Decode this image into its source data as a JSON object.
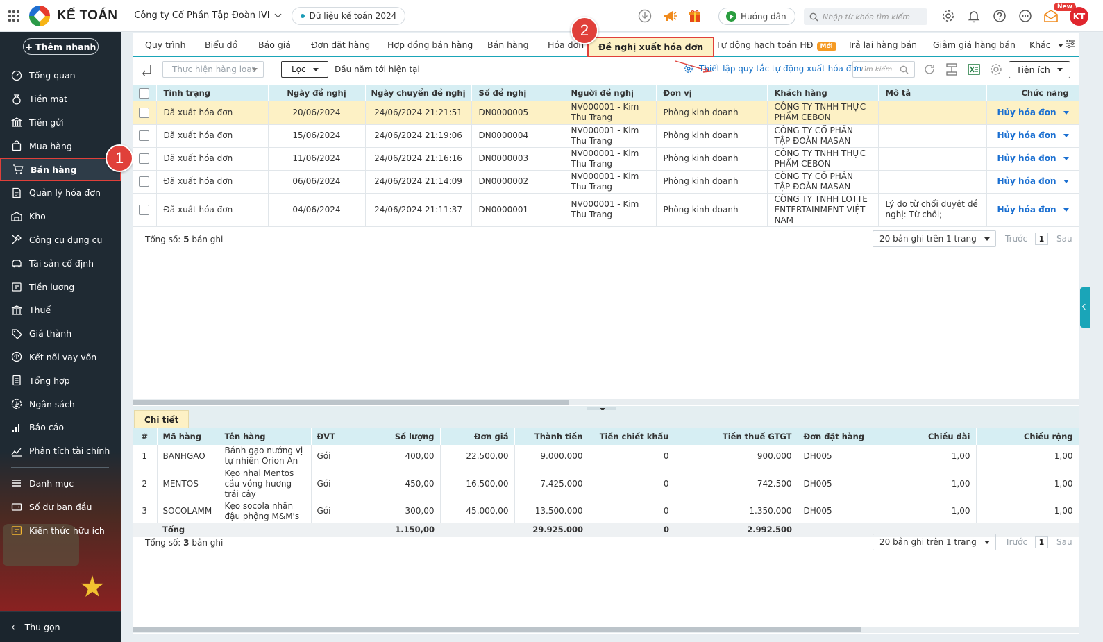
{
  "app": {
    "logo_text": "KẾ TOÁN",
    "company": "Công ty Cổ Phần Tập Đoàn IVI",
    "data_year": "Dữ liệu kế toán 2024",
    "guide_label": "Hướng dẫn",
    "search_placeholder": "Nhập từ khóa tìm kiếm",
    "new_badge": "New",
    "avatar_initials": "KT"
  },
  "sidebar": {
    "quick_add": "Thêm nhanh",
    "items": [
      {
        "label": "Tổng quan",
        "icon": "dashboard-icon"
      },
      {
        "label": "Tiền mặt",
        "icon": "cash-icon"
      },
      {
        "label": "Tiền gửi",
        "icon": "bank-icon"
      },
      {
        "label": "Mua hàng",
        "icon": "purchase-bag-icon"
      },
      {
        "label": "Bán hàng",
        "icon": "cart-icon"
      },
      {
        "label": "Quản lý hóa đơn",
        "icon": "invoice-icon"
      },
      {
        "label": "Kho",
        "icon": "warehouse-icon"
      },
      {
        "label": "Công cụ dụng cụ",
        "icon": "tools-icon"
      },
      {
        "label": "Tài sản cố định",
        "icon": "asset-icon"
      },
      {
        "label": "Tiền lương",
        "icon": "salary-icon"
      },
      {
        "label": "Thuế",
        "icon": "tax-icon"
      },
      {
        "label": "Giá thành",
        "icon": "price-tag-icon"
      },
      {
        "label": "Kết nối vay vốn",
        "icon": "loan-icon"
      },
      {
        "label": "Tổng hợp",
        "icon": "summary-icon"
      },
      {
        "label": "Ngân sách",
        "icon": "budget-icon"
      },
      {
        "label": "Báo cáo",
        "icon": "report-icon"
      },
      {
        "label": "Phân tích tài chính",
        "icon": "analysis-icon"
      },
      {
        "label": "Danh mục",
        "icon": "list-icon"
      },
      {
        "label": "Số dư ban đầu",
        "icon": "balance-icon"
      },
      {
        "label": "Kiến thức hữu ích",
        "icon": "knowledge-icon"
      }
    ],
    "collapse_label": "Thu gọn"
  },
  "callouts": {
    "one": "1",
    "two": "2"
  },
  "tabs": [
    {
      "label": "Quy trình"
    },
    {
      "label": "Biểu đồ"
    },
    {
      "label": "Báo giá"
    },
    {
      "label": "Đơn đặt hàng"
    },
    {
      "label": "Hợp đồng bán hàng"
    },
    {
      "label": "Bán hàng"
    },
    {
      "label": "Hóa đơn"
    },
    {
      "label": "Đề nghị xuất hóa đơn"
    },
    {
      "label": "Tự động hạch toán HĐ",
      "badge": "Mới"
    },
    {
      "label": "Trả lại hàng bán"
    },
    {
      "label": "Giảm giá hàng bán"
    },
    {
      "label": "Khác"
    }
  ],
  "toolbar": {
    "bulk_placeholder": "Thực hiện hàng loạt",
    "filter_label": "Lọc",
    "period": "Đầu năm tới hiện tại",
    "setup_link": "Thiết lập quy tắc tự động xuất hóa đơn",
    "search_placeholder": "Tìm kiếm",
    "utilities_label": "Tiện ích"
  },
  "proposals": {
    "columns": [
      "Tình trạng",
      "Ngày đề nghị",
      "Ngày chuyển đề nghị",
      "Số đề nghị",
      "Người đề nghị",
      "Đơn vị",
      "Khách hàng",
      "Mô tả",
      "Chức năng"
    ],
    "rows": [
      {
        "status": "Đã xuất hóa đơn",
        "date": "20/06/2024",
        "sent": "24/06/2024 21:21:51",
        "number": "DN0000005",
        "requester": "NV000001 - Kim Thu Trang",
        "unit": "Phòng kinh doanh",
        "customer": "CÔNG TY TNHH THỰC PHẨM CEBON",
        "note": "",
        "action": "Hủy hóa đơn"
      },
      {
        "status": "Đã xuất hóa đơn",
        "date": "15/06/2024",
        "sent": "24/06/2024 21:19:06",
        "number": "DN0000004",
        "requester": "NV000001 - Kim Thu Trang",
        "unit": "Phòng kinh doanh",
        "customer": "CÔNG TY CỔ PHẦN TẬP ĐOÀN MASAN",
        "note": "",
        "action": "Hủy hóa đơn"
      },
      {
        "status": "Đã xuất hóa đơn",
        "date": "11/06/2024",
        "sent": "24/06/2024 21:16:16",
        "number": "DN0000003",
        "requester": "NV000001 - Kim Thu Trang",
        "unit": "Phòng kinh doanh",
        "customer": "CÔNG TY TNHH THỰC PHẨM CEBON",
        "note": "",
        "action": "Hủy hóa đơn"
      },
      {
        "status": "Đã xuất hóa đơn",
        "date": "06/06/2024",
        "sent": "24/06/2024 21:14:09",
        "number": "DN0000002",
        "requester": "NV000001 - Kim Thu Trang",
        "unit": "Phòng kinh doanh",
        "customer": "CÔNG TY CỔ PHẦN TẬP ĐOÀN MASAN",
        "note": "",
        "action": "Hủy hóa đơn"
      },
      {
        "status": "Đã xuất hóa đơn",
        "date": "04/06/2024",
        "sent": "24/06/2024 21:11:37",
        "number": "DN0000001",
        "requester": "NV000001 - Kim Thu Trang",
        "unit": "Phòng kinh doanh",
        "customer": "CÔNG TY TNHH LOTTE ENTERTAINMENT VIỆT NAM",
        "note": "Lý do từ chối duyệt đề nghị: Từ chối;",
        "action": "Hủy hóa đơn"
      }
    ],
    "total_prefix": "Tổng số: ",
    "total_count": "5",
    "total_suffix": " bản ghi",
    "page_size": "20 bản ghi trên 1 trang",
    "prev": "Trước",
    "page": "1",
    "next": "Sau"
  },
  "detail": {
    "tab_label": "Chi tiết",
    "columns": [
      "#",
      "Mã hàng",
      "Tên hàng",
      "ĐVT",
      "Số lượng",
      "Đơn giá",
      "Thành tiền",
      "Tiền chiết khấu",
      "Tiền thuế GTGT",
      "Đơn đặt hàng",
      "Chiều dài",
      "Chiều rộng"
    ],
    "rows": [
      {
        "no": "1",
        "code": "BANHGAO",
        "name": "Bánh gạo nướng vị tự nhiên Orion An",
        "unit": "Gói",
        "qty": "400,00",
        "price": "22.500,00",
        "amount": "9.000.000",
        "discount": "0",
        "vat": "900.000",
        "order": "DH005",
        "length": "1,00",
        "width": "1,00"
      },
      {
        "no": "2",
        "code": "MENTOS",
        "name": "Kẹo nhai Mentos cầu vồng hương trái cây",
        "unit": "Gói",
        "qty": "450,00",
        "price": "16.500,00",
        "amount": "7.425.000",
        "discount": "0",
        "vat": "742.500",
        "order": "DH005",
        "length": "1,00",
        "width": "1,00"
      },
      {
        "no": "3",
        "code": "SOCOLAMM",
        "name": "Kẹo socola nhân đậu phộng M&M's",
        "unit": "Gói",
        "qty": "300,00",
        "price": "45.000,00",
        "amount": "13.500.000",
        "discount": "0",
        "vat": "1.350.000",
        "order": "DH005",
        "length": "1,00",
        "width": "1,00"
      }
    ],
    "sum": {
      "label": "Tổng",
      "qty": "1.150,00",
      "amount": "29.925.000",
      "discount": "0",
      "vat": "2.992.500"
    },
    "total_prefix": "Tổng số: ",
    "total_count": "3",
    "total_suffix": " bản ghi",
    "page_size": "20 bản ghi trên 1 trang",
    "prev": "Trước",
    "page": "1",
    "next": "Sau"
  },
  "colors": {
    "accent": "#1aa5b8",
    "highlight": "#fdf1c5",
    "callout": "#e0403a",
    "link": "#1a6fd1",
    "sidebar": "#1f2a33"
  }
}
